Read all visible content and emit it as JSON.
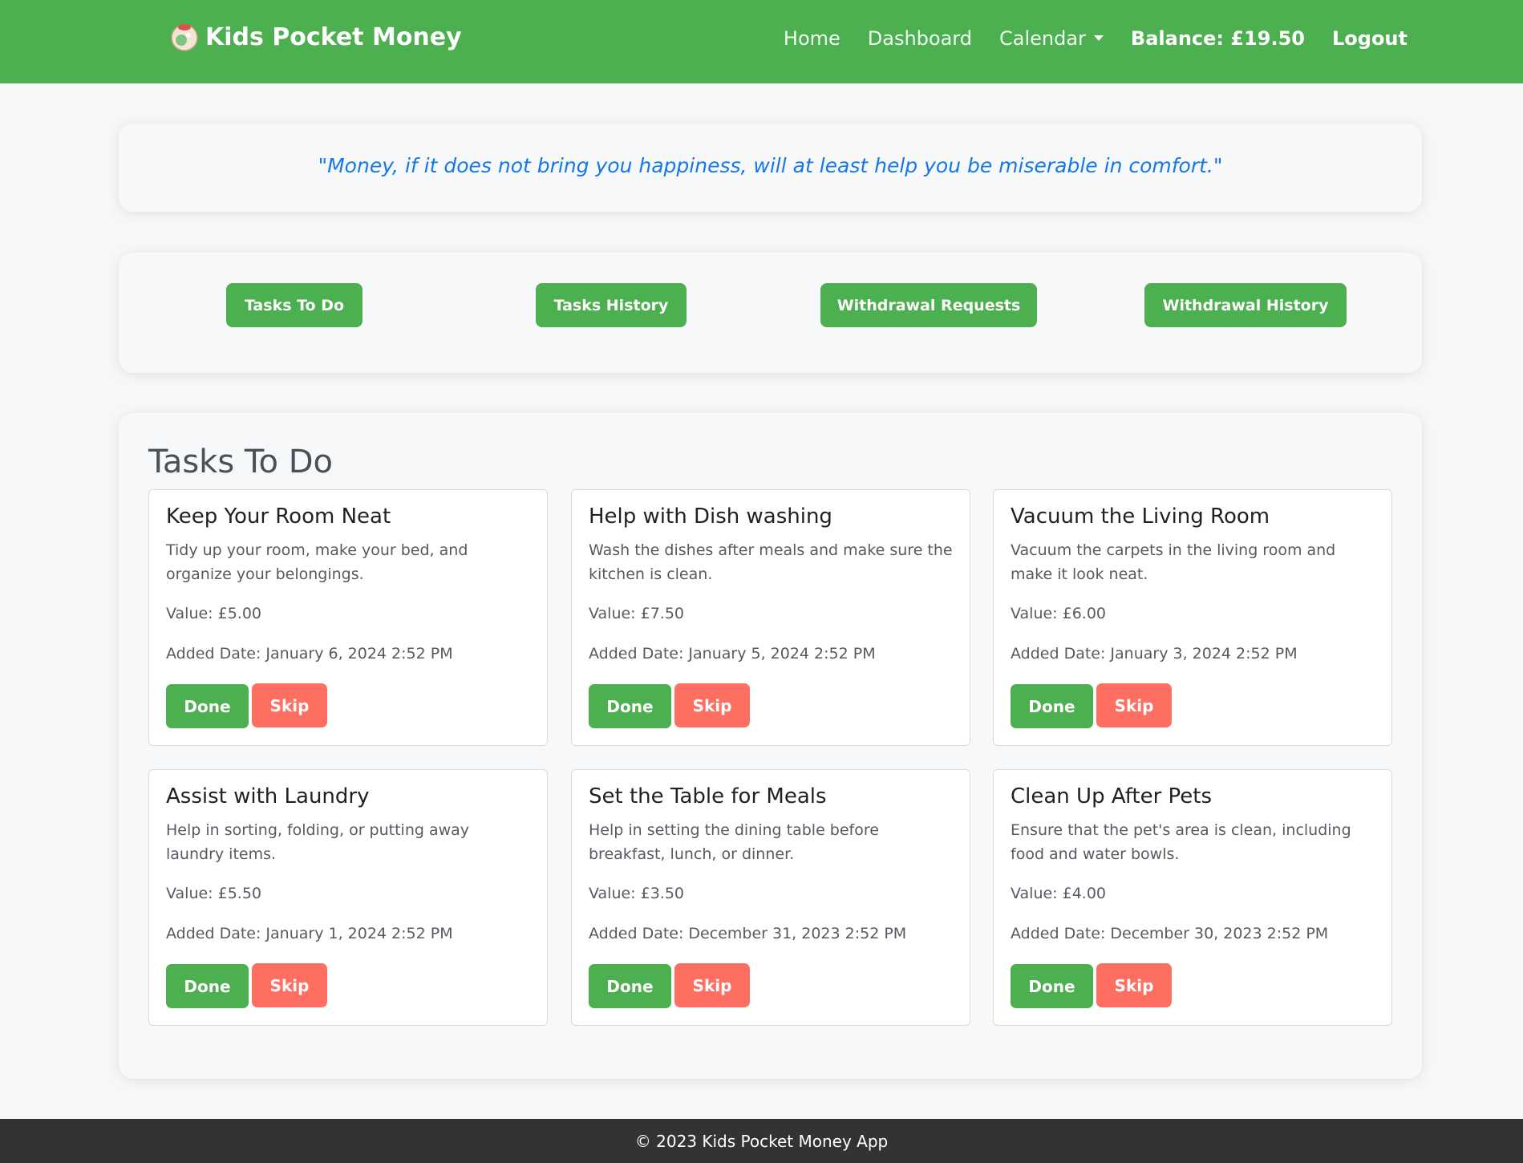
{
  "nav": {
    "brand": "Kids Pocket Money",
    "logo_icon": "piggy-bank-icon",
    "home": "Home",
    "dashboard": "Dashboard",
    "calendar": "Calendar",
    "balance": "Balance: £19.50",
    "logout": "Logout"
  },
  "quote": "\"Money, if it does not bring you happiness, will at least help you be miserable in comfort.\"",
  "actions": [
    "Tasks To Do",
    "Tasks History",
    "Withdrawal Requests",
    "Withdrawal History"
  ],
  "tasks_section": {
    "title": "Tasks To Do",
    "done_label": "Done",
    "skip_label": "Skip",
    "items": [
      {
        "title": "Keep Your Room Neat",
        "description": "Tidy up your room, make your bed, and organize your belongings.",
        "value": "Value: £5.00",
        "added": "Added Date: January 6, 2024 2:52 PM"
      },
      {
        "title": "Help with Dish washing",
        "description": "Wash the dishes after meals and make sure the kitchen is clean.",
        "value": "Value: £7.50",
        "added": "Added Date: January 5, 2024 2:52 PM"
      },
      {
        "title": "Vacuum the Living Room",
        "description": "Vacuum the carpets in the living room and make it look neat.",
        "value": "Value: £6.00",
        "added": "Added Date: January 3, 2024 2:52 PM"
      },
      {
        "title": "Assist with Laundry",
        "description": "Help in sorting, folding, or putting away laundry items.",
        "value": "Value: £5.50",
        "added": "Added Date: January 1, 2024 2:52 PM"
      },
      {
        "title": "Set the Table for Meals",
        "description": "Help in setting the dining table before breakfast, lunch, or dinner.",
        "value": "Value: £3.50",
        "added": "Added Date: December 31, 2023 2:52 PM"
      },
      {
        "title": "Clean Up After Pets",
        "description": "Ensure that the pet's area is clean, including food and water bowls.",
        "value": "Value: £4.00",
        "added": "Added Date: December 30, 2023 2:52 PM"
      }
    ]
  },
  "footer": "© 2023 Kids Pocket Money App",
  "colors": {
    "primary": "#4caf50",
    "skip": "#ff6f61",
    "quote": "#1677e8",
    "footer": "#333333"
  }
}
